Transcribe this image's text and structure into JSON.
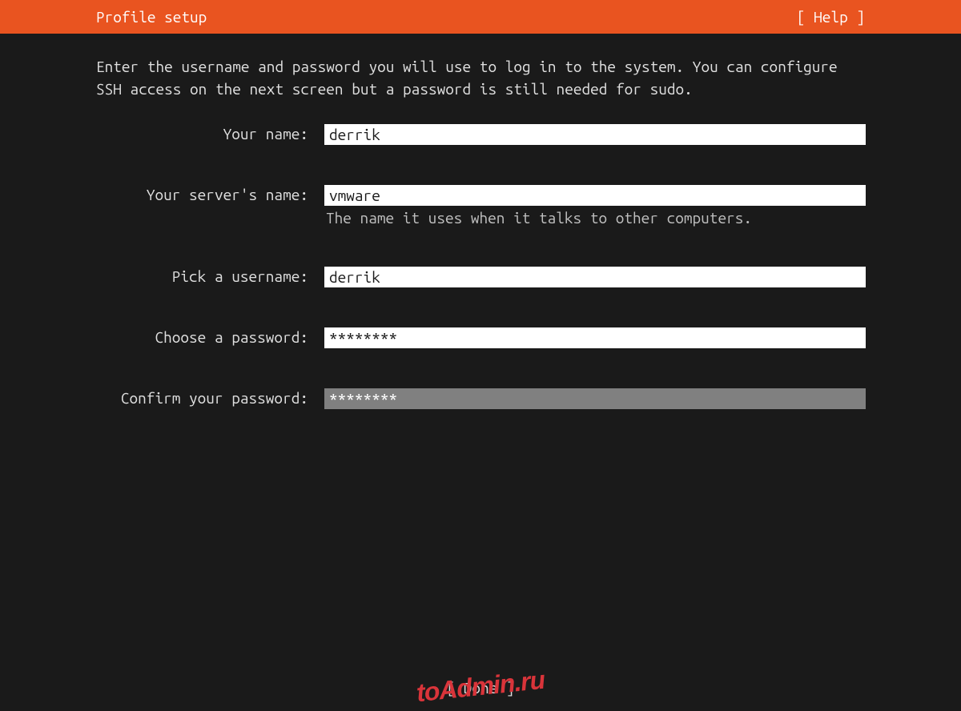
{
  "header": {
    "title": "Profile setup",
    "help_label": "[ Help ]"
  },
  "instructions": "Enter the username and password you will use to log in to the system. You can configure SSH access on the next screen but a password is still needed for sudo.",
  "form": {
    "your_name": {
      "label": "Your name:",
      "value": "derrik"
    },
    "server_name": {
      "label": "Your server's name:",
      "value": "vmware",
      "hint": "The name it uses when it talks to other computers."
    },
    "username": {
      "label": "Pick a username:",
      "value": "derrik"
    },
    "password": {
      "label": "Choose a password:",
      "value": "********"
    },
    "confirm_password": {
      "label": "Confirm your password:",
      "value": "********"
    }
  },
  "footer": {
    "done_label": "[ Done            ]"
  },
  "watermark": "toAdmin.ru",
  "colors": {
    "header_bg": "#e95420",
    "body_bg": "#1a1a1a",
    "input_bg": "#ffffff",
    "focused_input_bg": "#808080",
    "text": "#e0e0e0"
  }
}
